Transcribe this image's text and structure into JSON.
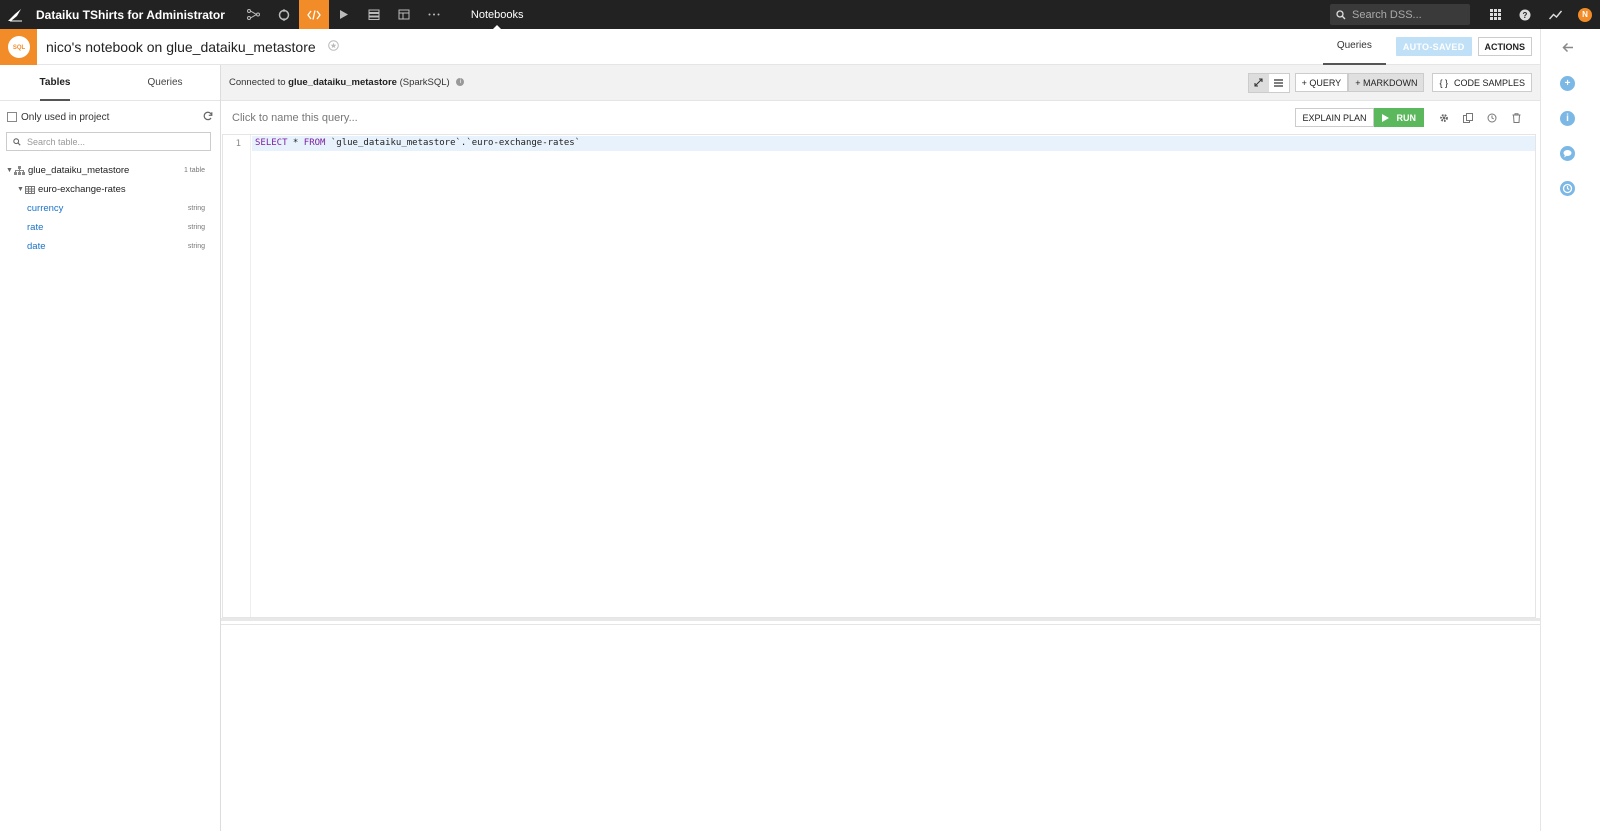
{
  "app": {
    "project_title": "Dataiku TShirts for Administrator",
    "section_label": "Notebooks",
    "search_placeholder": "Search DSS...",
    "avatar_initial": "N",
    "accent_color": "#f28c28"
  },
  "nav_icons": [
    "flow-icon",
    "cycle-icon",
    "code-icon",
    "play-icon",
    "dataset-icon",
    "dashboard-icon",
    "more-icon"
  ],
  "header": {
    "notebook_title": "nico's notebook on glue_dataiku_metastore",
    "tab_label": "Queries",
    "autosaved_label": "AUTO-SAVED",
    "actions_label": "ACTIONS"
  },
  "left_panel": {
    "tabs": [
      "Tables",
      "Queries"
    ],
    "filter_label": "Only used in project",
    "search_placeholder": "Search table...",
    "database": {
      "name": "glue_dataiku_metastore",
      "count": "1 table"
    },
    "table": {
      "name": "euro-exchange-rates"
    },
    "columns": [
      {
        "name": "currency",
        "type": "string"
      },
      {
        "name": "rate",
        "type": "string"
      },
      {
        "name": "date",
        "type": "string"
      }
    ]
  },
  "toolbar": {
    "connected_prefix": "Connected to",
    "connection_name": "glue_dataiku_metastore",
    "connection_type": "(SparkSQL)",
    "add_query_label": "+ QUERY",
    "add_markdown_label": "+ MARKDOWN",
    "code_samples_label": "CODE SAMPLES"
  },
  "editor": {
    "query_name_placeholder": "Click to name this query...",
    "explain_label": "EXPLAIN PLAN",
    "run_label": "RUN",
    "line_number": "1",
    "kw_select": "SELECT",
    "star": " * ",
    "kw_from": "FROM",
    "code_rest": " `glue_dataiku_metastore`.`euro-exchange-rates`"
  }
}
